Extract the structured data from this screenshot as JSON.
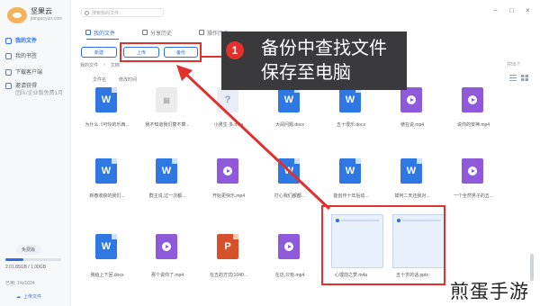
{
  "app": {
    "name": "坚果云",
    "subtitle": "jianguoyun.com"
  },
  "sidebar": {
    "items": [
      {
        "label": "我的文件",
        "active": true
      },
      {
        "label": "我的书签"
      },
      {
        "label": "下载客户端"
      },
      {
        "label": "邀请获得",
        "sub": "团队/企业版免费1月"
      }
    ],
    "space_pill": "免费版",
    "space_text": "2.01.85GB / 1.00GB",
    "footer": "已用: 1%/1024",
    "upload": "上传文件",
    "storage_fraction": 0.32
  },
  "search": {
    "placeholder": "搜索我的文件"
  },
  "tabs": [
    {
      "label": "我的文件",
      "active": true
    },
    {
      "label": "分享历史"
    },
    {
      "label": "操作历史"
    }
  ],
  "buttons": {
    "new": "新建",
    "upload": "上传",
    "backup": "备份"
  },
  "breadcrumb": {
    "root": "我的文件",
    "current": "文档"
  },
  "columns": {
    "name": "文件名",
    "time": "修改时间"
  },
  "count_text": "共55个",
  "callout": {
    "number": "1",
    "line1": "备份中查找文件",
    "line2": "保存至电脑"
  },
  "files": [
    {
      "type": "word",
      "name": "为什么《可怜的乐西..."
    },
    {
      "type": "cal",
      "name": "我不知道我们算不算..."
    },
    {
      "type": "unknown",
      "name": "小男生 多.m4a"
    },
    {
      "type": "word",
      "name": "大阅问题.docx"
    },
    {
      "type": "word",
      "name": "五十很乐.docx"
    },
    {
      "type": "video",
      "name": "使在说.mp4"
    },
    {
      "type": "video",
      "name": "说你的安神.mp4"
    },
    {
      "type": "word",
      "name": "新春收获的我们..."
    },
    {
      "type": "word",
      "name": "群主说,过一次都..."
    },
    {
      "type": "video",
      "name": "开始更快乐.mp4"
    },
    {
      "type": "word",
      "name": "打心我们都都..."
    },
    {
      "type": "word",
      "name": "能创作十年后动..."
    },
    {
      "type": "word",
      "name": "如何二天还我对..."
    },
    {
      "type": "video",
      "name": "一个全然男子的五..."
    },
    {
      "type": "word",
      "name": "我给上下回.docx"
    },
    {
      "type": "video",
      "name": "那个说你了.mp4"
    },
    {
      "type": "ppt",
      "name": "在五的方式(1040..."
    },
    {
      "type": "video",
      "name": "在这,只有.mp4"
    },
    {
      "type": "unknown",
      "name": "心理前之梦.m4a"
    },
    {
      "type": "ppt",
      "name": "五十岁的话.pptx"
    }
  ],
  "watermark": "煎蛋手游"
}
